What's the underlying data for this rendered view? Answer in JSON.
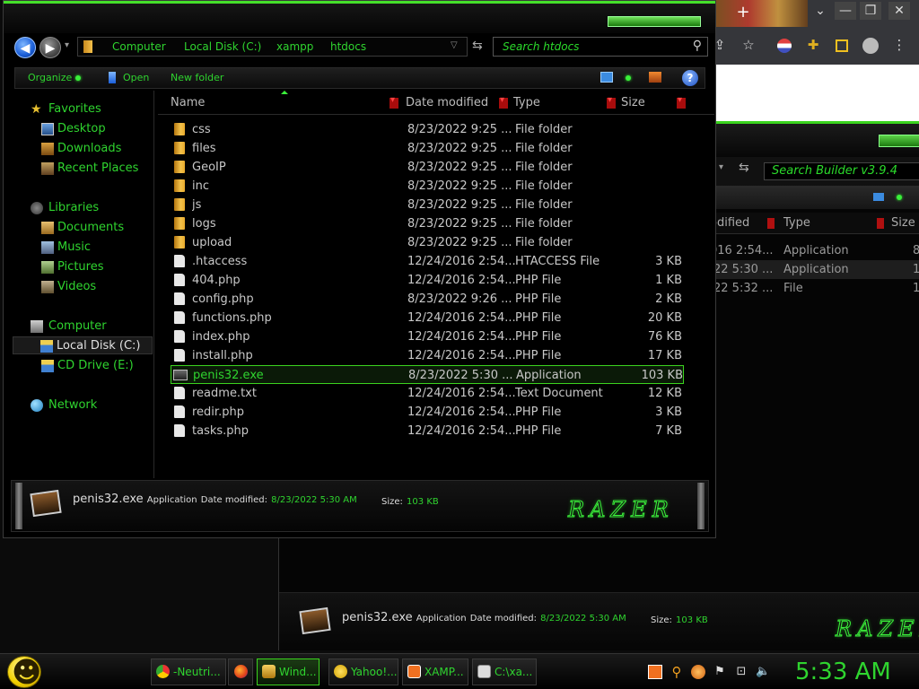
{
  "browser": {
    "new_tab": "+",
    "win_buttons": [
      "⌄",
      "—",
      "❐",
      "✕"
    ],
    "toolbar_icons": [
      "share-icon",
      "star-icon",
      "profile-icon",
      "extensions-icon",
      "sidepanel-icon",
      "account-icon",
      "menu-icon"
    ]
  },
  "back_window": {
    "search_placeholder": "Search Builder v3.9.4",
    "columns": [
      "odified",
      "Type",
      "Size"
    ],
    "rows": [
      {
        "date": "016 2:54...",
        "type": "Application",
        "size": "8"
      },
      {
        "date": "22 5:30 ...",
        "type": "Application",
        "size": "1"
      },
      {
        "date": "22 5:32 ...",
        "type": "File",
        "size": "1"
      }
    ],
    "details": {
      "name": "penis32.exe",
      "kind": "Application",
      "date_label": "Date modified:",
      "date_value": "8/23/2022 5:30 AM",
      "size_label": "Size:",
      "size_value": "103 KB"
    }
  },
  "explorer": {
    "breadcrumb": [
      "Computer",
      "Local Disk (C:)",
      "xampp",
      "htdocs"
    ],
    "search_placeholder": "Search htdocs",
    "commands": {
      "organize": "Organize",
      "open": "Open",
      "new_folder": "New folder",
      "help": "?"
    },
    "nav": {
      "favorites": "Favorites",
      "desktop": "Desktop",
      "downloads": "Downloads",
      "recent": "Recent Places",
      "libraries": "Libraries",
      "documents": "Documents",
      "music": "Music",
      "pictures": "Pictures",
      "videos": "Videos",
      "computer": "Computer",
      "local_disk": "Local Disk (C:)",
      "cd_drive": "CD Drive (E:)",
      "network": "Network"
    },
    "columns": {
      "name": "Name",
      "date": "Date modified",
      "type": "Type",
      "size": "Size"
    },
    "files": [
      {
        "name": "css",
        "date": "8/23/2022 9:25 ...",
        "type": "File folder",
        "size": "",
        "icon": "folder"
      },
      {
        "name": "files",
        "date": "8/23/2022 9:25 ...",
        "type": "File folder",
        "size": "",
        "icon": "folder"
      },
      {
        "name": "GeoIP",
        "date": "8/23/2022 9:25 ...",
        "type": "File folder",
        "size": "",
        "icon": "folder"
      },
      {
        "name": "inc",
        "date": "8/23/2022 9:25 ...",
        "type": "File folder",
        "size": "",
        "icon": "folder"
      },
      {
        "name": "js",
        "date": "8/23/2022 9:25 ...",
        "type": "File folder",
        "size": "",
        "icon": "folder"
      },
      {
        "name": "logs",
        "date": "8/23/2022 9:25 ...",
        "type": "File folder",
        "size": "",
        "icon": "folder"
      },
      {
        "name": "upload",
        "date": "8/23/2022 9:25 ...",
        "type": "File folder",
        "size": "",
        "icon": "folder"
      },
      {
        "name": ".htaccess",
        "date": "12/24/2016 2:54...",
        "type": "HTACCESS File",
        "size": "3 KB",
        "icon": "file"
      },
      {
        "name": "404.php",
        "date": "12/24/2016 2:54...",
        "type": "PHP File",
        "size": "1 KB",
        "icon": "file"
      },
      {
        "name": "config.php",
        "date": "8/23/2022 9:26 ...",
        "type": "PHP File",
        "size": "2 KB",
        "icon": "file"
      },
      {
        "name": "functions.php",
        "date": "12/24/2016 2:54...",
        "type": "PHP File",
        "size": "20 KB",
        "icon": "file"
      },
      {
        "name": "index.php",
        "date": "12/24/2016 2:54...",
        "type": "PHP File",
        "size": "76 KB",
        "icon": "file"
      },
      {
        "name": "install.php",
        "date": "12/24/2016 2:54...",
        "type": "PHP File",
        "size": "17 KB",
        "icon": "file"
      },
      {
        "name": "penis32.exe",
        "date": "8/23/2022 5:30 ...",
        "type": "Application",
        "size": "103 KB",
        "icon": "exe",
        "selected": true
      },
      {
        "name": "readme.txt",
        "date": "12/24/2016 2:54...",
        "type": "Text Document",
        "size": "12 KB",
        "icon": "file"
      },
      {
        "name": "redir.php",
        "date": "12/24/2016 2:54...",
        "type": "PHP File",
        "size": "3 KB",
        "icon": "file"
      },
      {
        "name": "tasks.php",
        "date": "12/24/2016 2:54...",
        "type": "PHP File",
        "size": "7 KB",
        "icon": "file"
      }
    ],
    "details": {
      "name": "penis32.exe",
      "kind": "Application",
      "date_label": "Date modified:",
      "date_value": "8/23/2022 5:30 AM",
      "size_label": "Size:",
      "size_value": "103 KB"
    }
  },
  "taskbar": {
    "buttons": [
      {
        "label": "-Neutri...",
        "icon": "chrome-icon"
      },
      {
        "label": "",
        "icon": "firefox-icon"
      },
      {
        "label": "Wind...",
        "icon": "explorer-icon",
        "active": true
      },
      {
        "label": "Yahoo!...",
        "icon": "yahoo-icon"
      },
      {
        "label": "XAMP...",
        "icon": "xampp-icon"
      },
      {
        "label": "C:\\xa...",
        "icon": "cmd-icon"
      }
    ],
    "clock": "5:33 AM"
  },
  "colors": {
    "accent": "#2fd42f",
    "frame": "#45e02a",
    "background": "#000000",
    "header_sep": "#a80c0c"
  }
}
